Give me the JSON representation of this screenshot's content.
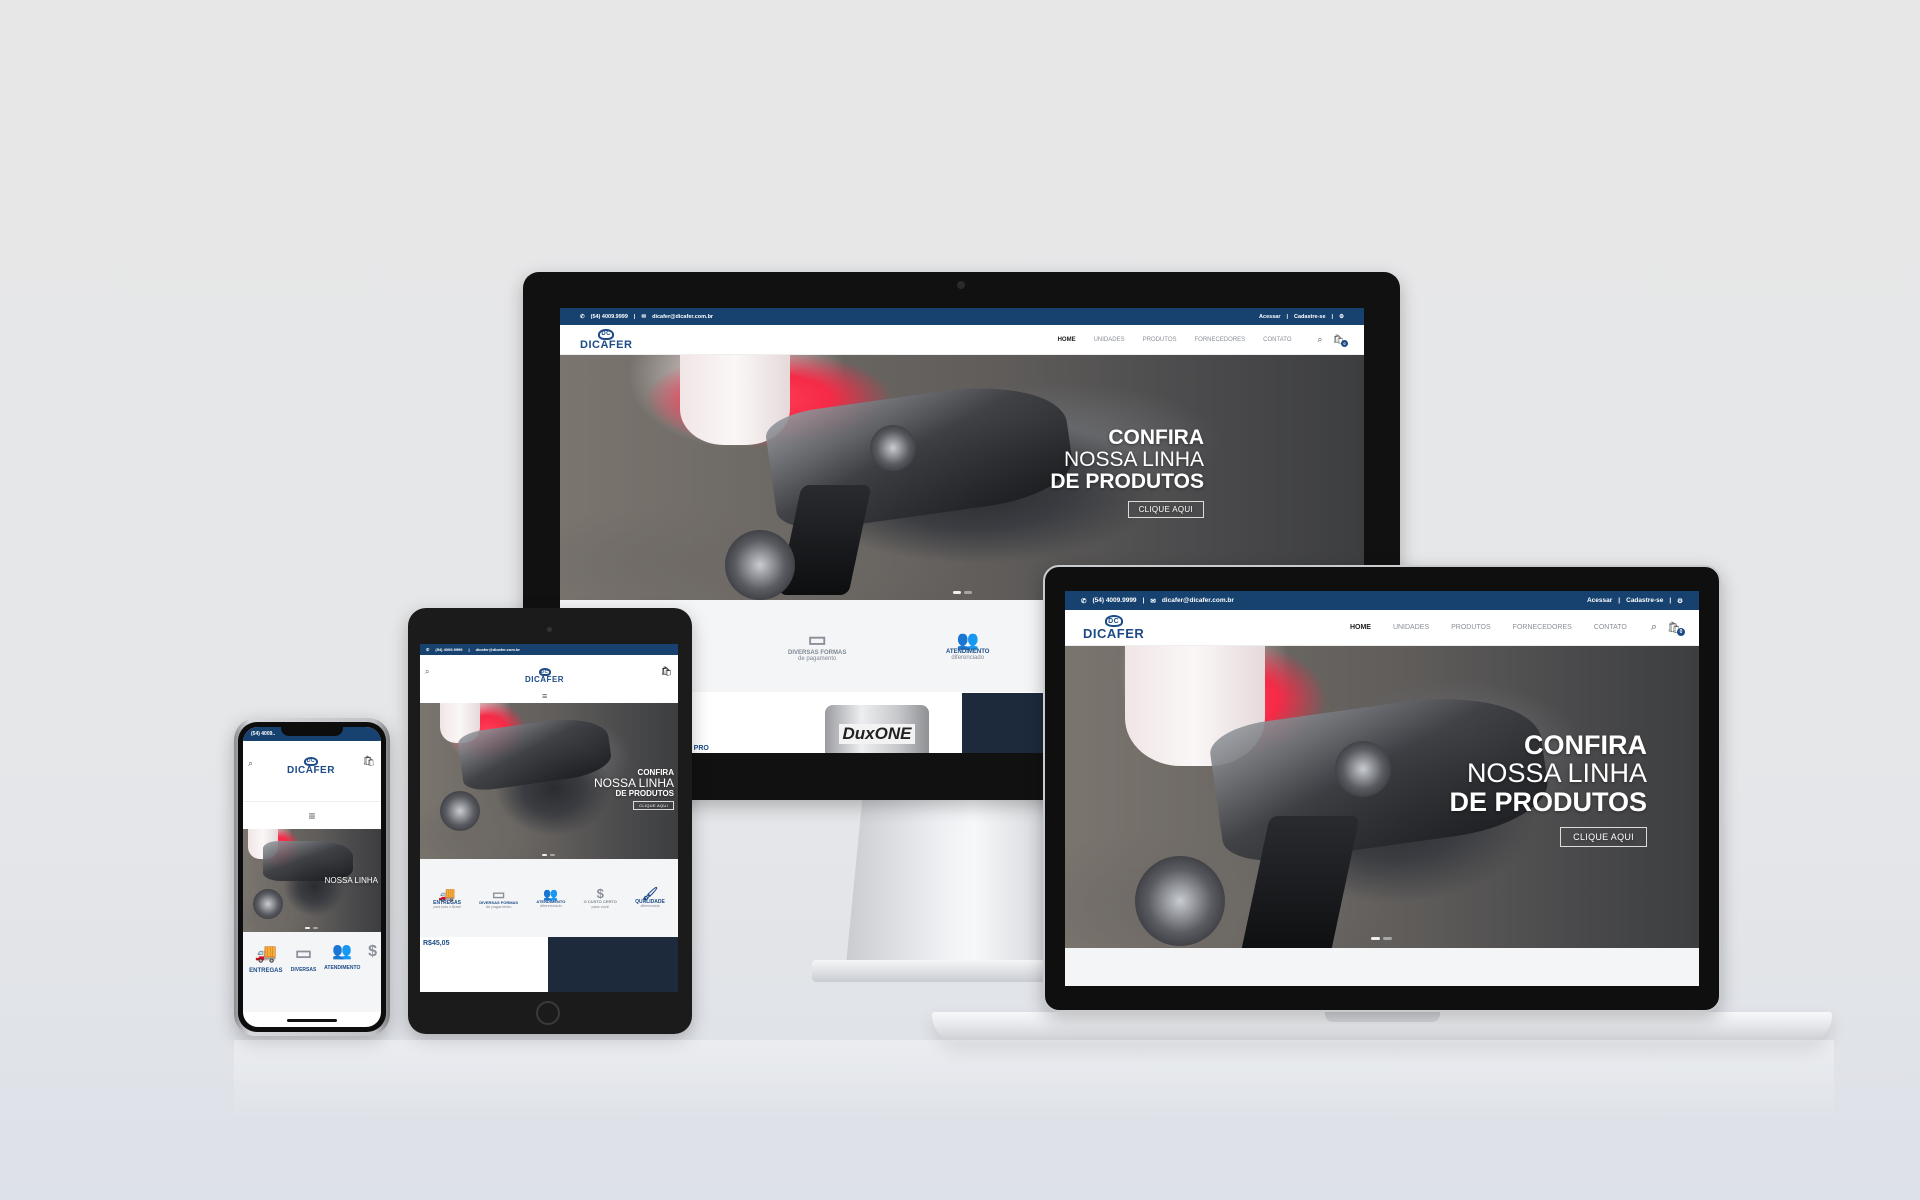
{
  "site": {
    "phone": "(54) 4009.9999",
    "email": "dicafer@dicafer.com.br",
    "account_links": [
      "Acessar",
      "Cadastre-se"
    ],
    "brand": "DICAFER",
    "brand_mark": "DC",
    "nav": [
      "HOME",
      "UNIDADES",
      "PRODUTOS",
      "FORNECEDORES",
      "CONTATO"
    ],
    "cart_count": "0",
    "hero": {
      "line1": "CONFIRA",
      "line2": "NOSSA LINHA",
      "line3": "DE PRODUTOS",
      "cta": "CLIQUE AQUI"
    },
    "features": [
      {
        "title": "ENTREGAS",
        "sub": "para todo o Brasil",
        "icon": "truck-icon"
      },
      {
        "title": "DIVERSAS FORMAS",
        "sub": "de pagamento",
        "icon": "credit-card-icon"
      },
      {
        "title": "ATENDIMENTO",
        "sub": "diferenciado",
        "icon": "people-icon"
      },
      {
        "title": "O CUSTO CERTO",
        "sub": "para você",
        "icon": "dollar-icon"
      },
      {
        "title": "QUALIDADE",
        "sub": "diferenciada",
        "icon": "paint-icon"
      }
    ],
    "product_brand": "DuxONE",
    "product_label_partial": "NE PRO",
    "price": "R$45,05"
  },
  "phone_device": {
    "status_time": "(54) 4009..",
    "feature_titles": [
      "ENTREGAS",
      "DIVERSAS",
      "ATENDIMENTO"
    ]
  },
  "colors": {
    "brand_blue": "#17426f",
    "accent": "#1c4b86",
    "page_bg": "#e7e7e8"
  }
}
